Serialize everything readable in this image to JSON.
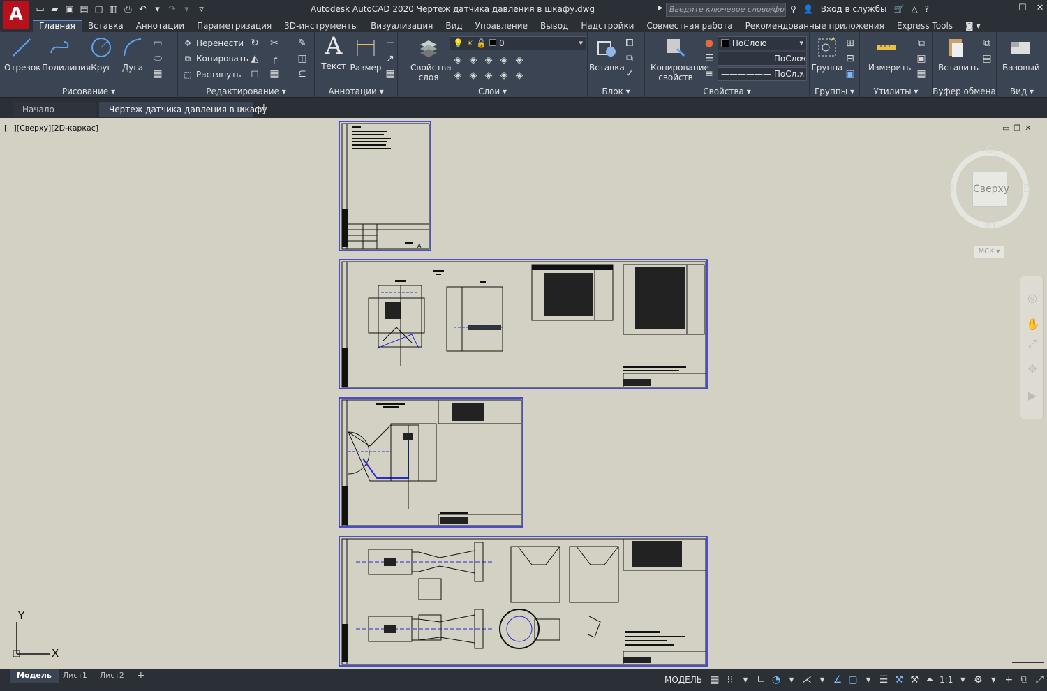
{
  "app": {
    "logo": "A",
    "title": "Autodesk AutoCAD 2020   Чертеж датчика давления в шкафу.dwg",
    "search_placeholder": "Введите ключевое слово/фразу",
    "signin": "Вход в службы"
  },
  "ribbon_tabs": [
    "Главная",
    "Вставка",
    "Аннотации",
    "Параметризация",
    "3D-инструменты",
    "Визуализация",
    "Вид",
    "Управление",
    "Вывод",
    "Надстройки",
    "Совместная работа",
    "Рекомендованные приложения",
    "Express Tools"
  ],
  "panels": {
    "draw": {
      "label": "Рисование",
      "line": "Отрезок",
      "polyline": "Полилиния",
      "circle": "Круг",
      "arc": "Дуга"
    },
    "modify": {
      "label": "Редактирование",
      "move": "Перенести",
      "copy": "Копировать",
      "stretch": "Растянуть"
    },
    "annotation": {
      "label": "Аннотации",
      "text": "Текст",
      "dimension": "Размер"
    },
    "layers": {
      "label": "Слои",
      "layer_props": "Свойства слоя",
      "current_layer": "0"
    },
    "block": {
      "label": "Блок",
      "insert": "Вставка"
    },
    "properties": {
      "label": "Свойства",
      "match": "Копирование свойств",
      "color": "ПоСлою",
      "linetype": "ПоСлою",
      "lineweight": "ПоСл..."
    },
    "groups": {
      "label": "Группы",
      "group": "Группа"
    },
    "utilities": {
      "label": "Утилиты",
      "measure": "Измерить"
    },
    "clipboard": {
      "label": "Буфер обмена",
      "paste": "Вставить"
    },
    "view": {
      "label": "Вид",
      "base": "Базовый"
    }
  },
  "doc_tabs": {
    "home": "Начало",
    "drawing": "Чертеж датчика давления в шкафу",
    "close": "✕",
    "add": "+"
  },
  "viewport": {
    "label": "[−][Сверху][2D-каркас]",
    "viewcube": {
      "face": "Сверху",
      "north": "С",
      "south": "Ю",
      "west": "З",
      "east": "В",
      "wcs": "МСК"
    },
    "ucs": {
      "x": "X",
      "y": "Y"
    }
  },
  "layout_tabs": [
    "Модель",
    "Лист1",
    "Лист2",
    "+"
  ],
  "status": {
    "model": "МОДЕЛЬ",
    "scale": "1:1"
  },
  "colors": {
    "drawing_bg": "#d2d1c4",
    "sheet_border": "#2a2ad4",
    "ribbon_bg": "#3b4453",
    "title_bg": "#2b2f36",
    "logo": "#b8111b"
  }
}
